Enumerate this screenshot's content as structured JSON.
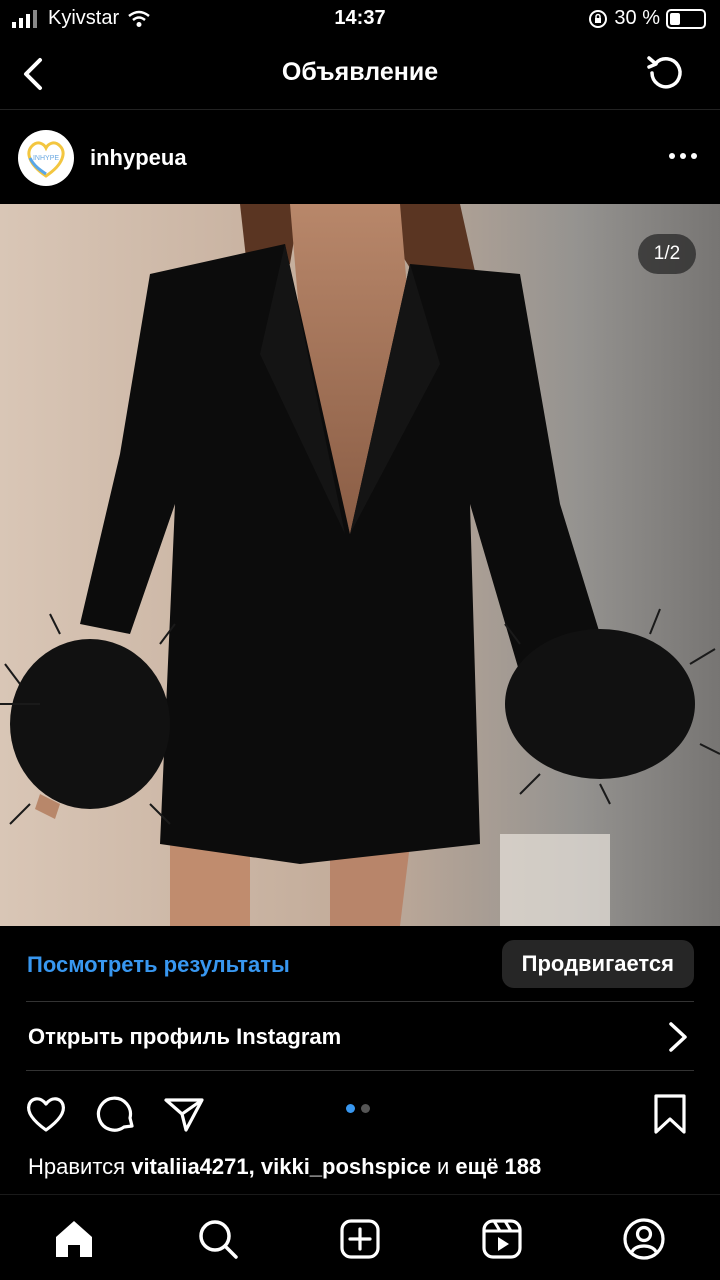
{
  "status_bar": {
    "carrier": "Kyivstar",
    "time": "14:37",
    "battery_text": "30 %",
    "battery_level": 0.3
  },
  "header": {
    "title": "Объявление",
    "back_icon": "chevron-left-icon",
    "refresh_icon": "refresh-icon"
  },
  "post": {
    "username": "inhypeua",
    "avatar_text": "INHYPE",
    "image_counter": "1/2",
    "current_slide": 1,
    "total_slides": 2
  },
  "cta": {
    "view_results": "Посмотреть результаты",
    "promoting": "Продвигается",
    "open_profile": "Открыть профиль Instagram"
  },
  "likes": {
    "prefix": "Нравится",
    "user1": "vitaliia4271,",
    "user2": "vikki_poshspice",
    "connector": "и",
    "more": "ещё 188"
  },
  "colors": {
    "accent": "#3897f0",
    "background": "#000000",
    "button_bg": "#262626"
  },
  "nav": [
    "home-icon",
    "search-icon",
    "add-post-icon",
    "reels-icon",
    "profile-icon"
  ]
}
